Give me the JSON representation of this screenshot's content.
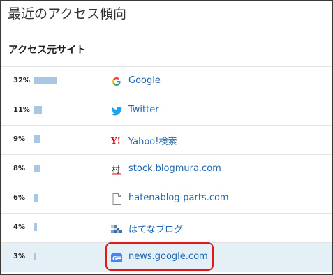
{
  "title": "最近のアクセス傾向",
  "section_title": "アクセス元サイト",
  "rows": [
    {
      "percent": "32%",
      "share": 0.32,
      "site": "Google",
      "icon": "google-icon"
    },
    {
      "percent": "11%",
      "share": 0.11,
      "site": "Twitter",
      "icon": "twitter-icon"
    },
    {
      "percent": "9%",
      "share": 0.09,
      "site": "Yahoo!検索",
      "icon": "yahoo-icon"
    },
    {
      "percent": "8%",
      "share": 0.08,
      "site": "stock.blogmura.com",
      "icon": "blogmura-icon"
    },
    {
      "percent": "6%",
      "share": 0.06,
      "site": "hatenablog-parts.com",
      "icon": "document-icon"
    },
    {
      "percent": "4%",
      "share": 0.04,
      "site": "はてなブログ",
      "icon": "hatena-blog-icon"
    },
    {
      "percent": "3%",
      "share": 0.03,
      "site": "news.google.com",
      "icon": "google-news-icon"
    }
  ],
  "colors": {
    "bar": "#a9c7e3",
    "link": "#1f67b0",
    "highlight_row": "#e5f0f6",
    "callout": "#e31919"
  }
}
